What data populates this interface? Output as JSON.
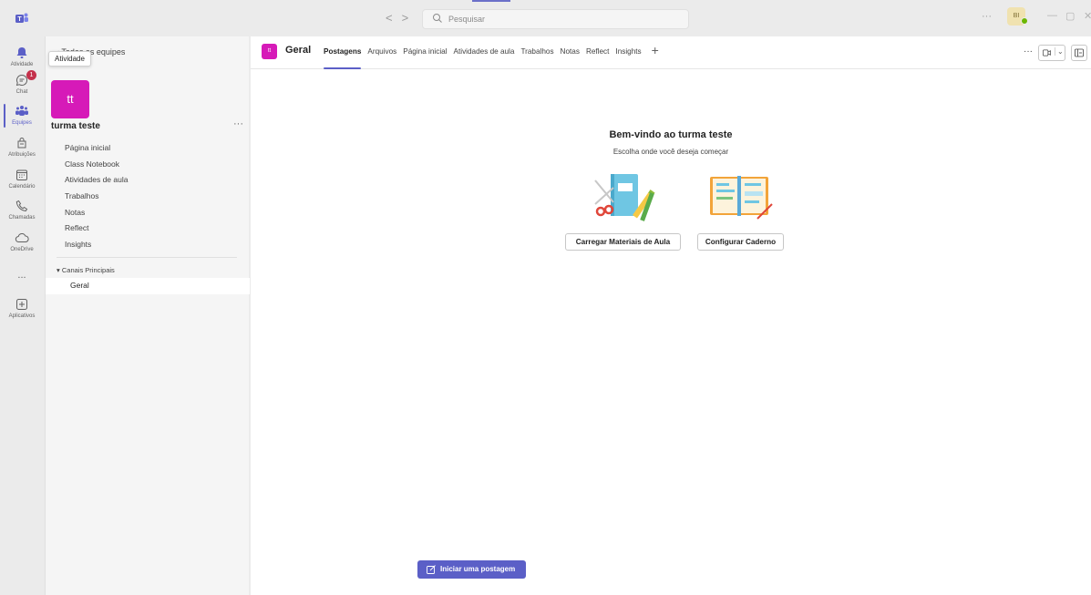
{
  "titlebar": {
    "search_placeholder": "Pesquisar",
    "avatar_initials": "BI"
  },
  "rail": {
    "items": [
      {
        "label": "Atividade",
        "icon": "bell-icon"
      },
      {
        "label": "Chat",
        "icon": "chat-icon",
        "badge": "1"
      },
      {
        "label": "Equipes",
        "icon": "teams-icon"
      },
      {
        "label": "Atribuições",
        "icon": "assignments-icon"
      },
      {
        "label": "Calendário",
        "icon": "calendar-icon"
      },
      {
        "label": "Chamadas",
        "icon": "phone-icon"
      },
      {
        "label": "OneDrive",
        "icon": "cloud-icon"
      },
      {
        "label": "...",
        "icon": "more-icon"
      },
      {
        "label": "Aplicativos",
        "icon": "add-apps-icon"
      }
    ],
    "tooltip": "Atividade"
  },
  "team_panel": {
    "back_label": "Todas as equipes",
    "team_initials": "tt",
    "team_name": "turma teste",
    "menu": [
      "Página inicial",
      "Class Notebook",
      "Atividades de aula",
      "Trabalhos",
      "Notas",
      "Reflect",
      "Insights"
    ],
    "channels_header": "Canais Principais",
    "channel": "Geral"
  },
  "main": {
    "channel_avatar": "tt",
    "channel_title": "Geral",
    "tabs": [
      "Postagens",
      "Arquivos",
      "Página inicial",
      "Atividades de aula",
      "Trabalhos",
      "Notas",
      "Reflect",
      "Insights"
    ],
    "welcome_title": "Bem-vindo ao turma teste",
    "welcome_subtitle": "Escolha onde você deseja começar",
    "upload_button": "Carregar Materiais de Aula",
    "notebook_button": "Configurar Caderno",
    "post_button": "Iniciar uma postagem"
  },
  "colors": {
    "accent": "#5b5fc7",
    "team_tile": "#d61ab8",
    "badge": "#c4314b"
  }
}
